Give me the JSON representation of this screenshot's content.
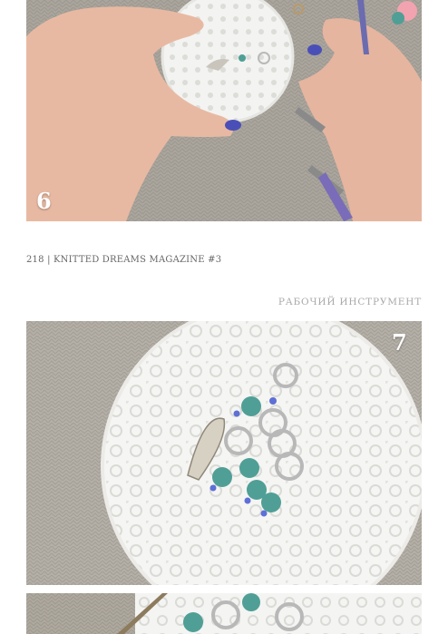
{
  "photos": [
    {
      "step": "6",
      "description_icon": "hands-working-with-pliers-photo"
    },
    {
      "step": "7",
      "description_icon": "stitch-markers-on-doily-photo"
    },
    {
      "step": "",
      "description_icon": "stitch-markers-closeup-photo"
    }
  ],
  "footer": {
    "text": "218 | KNITTED DREAMS MAGAZINE #3"
  },
  "section": {
    "title": "РАБОЧИЙ ИНСТРУМЕНТ"
  },
  "colors": {
    "background": "#ffffff",
    "footer_text": "#666666",
    "section_text": "#a9a9a9",
    "knit_gray": "#a9a49c",
    "bead_teal": "#4f9f96",
    "nail_blue": "#4a4fb8"
  }
}
